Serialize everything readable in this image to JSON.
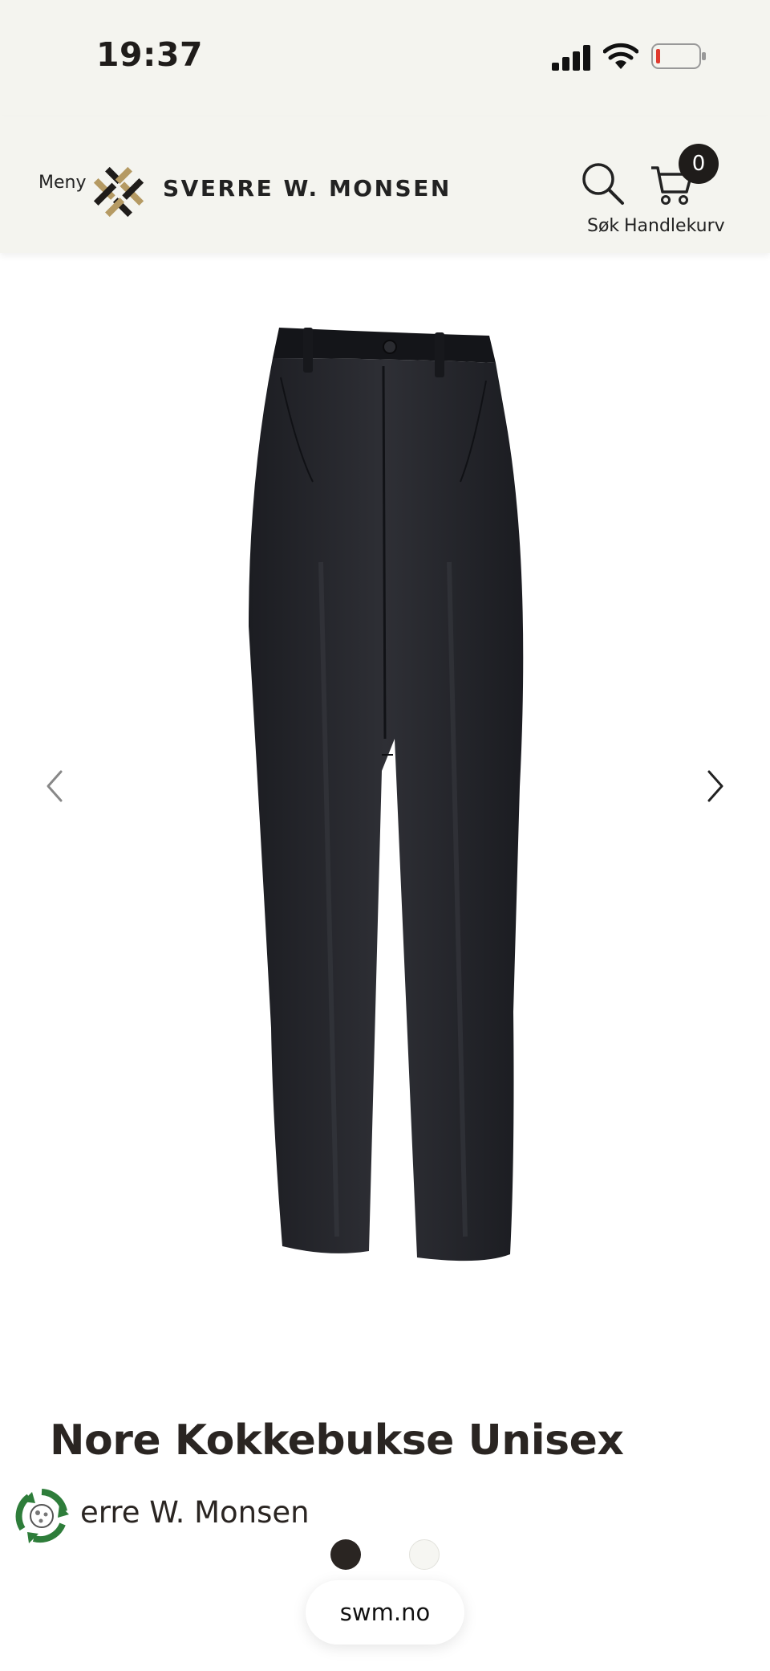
{
  "status_bar": {
    "time": "19:37",
    "signal_icon": "cellular-signal-icon",
    "wifi_icon": "wifi-icon",
    "battery_icon": "battery-low-icon",
    "battery_level": 0.08,
    "battery_color": "#e03a2e"
  },
  "header": {
    "menu_label": "Meny",
    "brand_name": "SVERRE W. MONSEN",
    "logo_icon": "woven-x-logo-icon",
    "search_label": "Søk",
    "search_icon": "search-icon",
    "cart_label": "Handlekurv",
    "cart_icon": "shopping-cart-icon",
    "cart_count": "0"
  },
  "carousel": {
    "prev_icon": "chevron-left-icon",
    "next_icon": "chevron-right-icon",
    "image_subject": "black chef trousers",
    "slide_count": 2,
    "active_slide": 1
  },
  "product": {
    "title": "Nore Kokkebukse Unisex",
    "brand_partial": "erre W. Monsen",
    "eco_badge_icon": "recycling-badge-icon"
  },
  "browser": {
    "url": "swm.no"
  },
  "colors": {
    "header_bg": "#f4f4ef",
    "text_dark": "#2a2522",
    "logo_gold": "#b59a63",
    "eco_green": "#2e7d3a"
  }
}
